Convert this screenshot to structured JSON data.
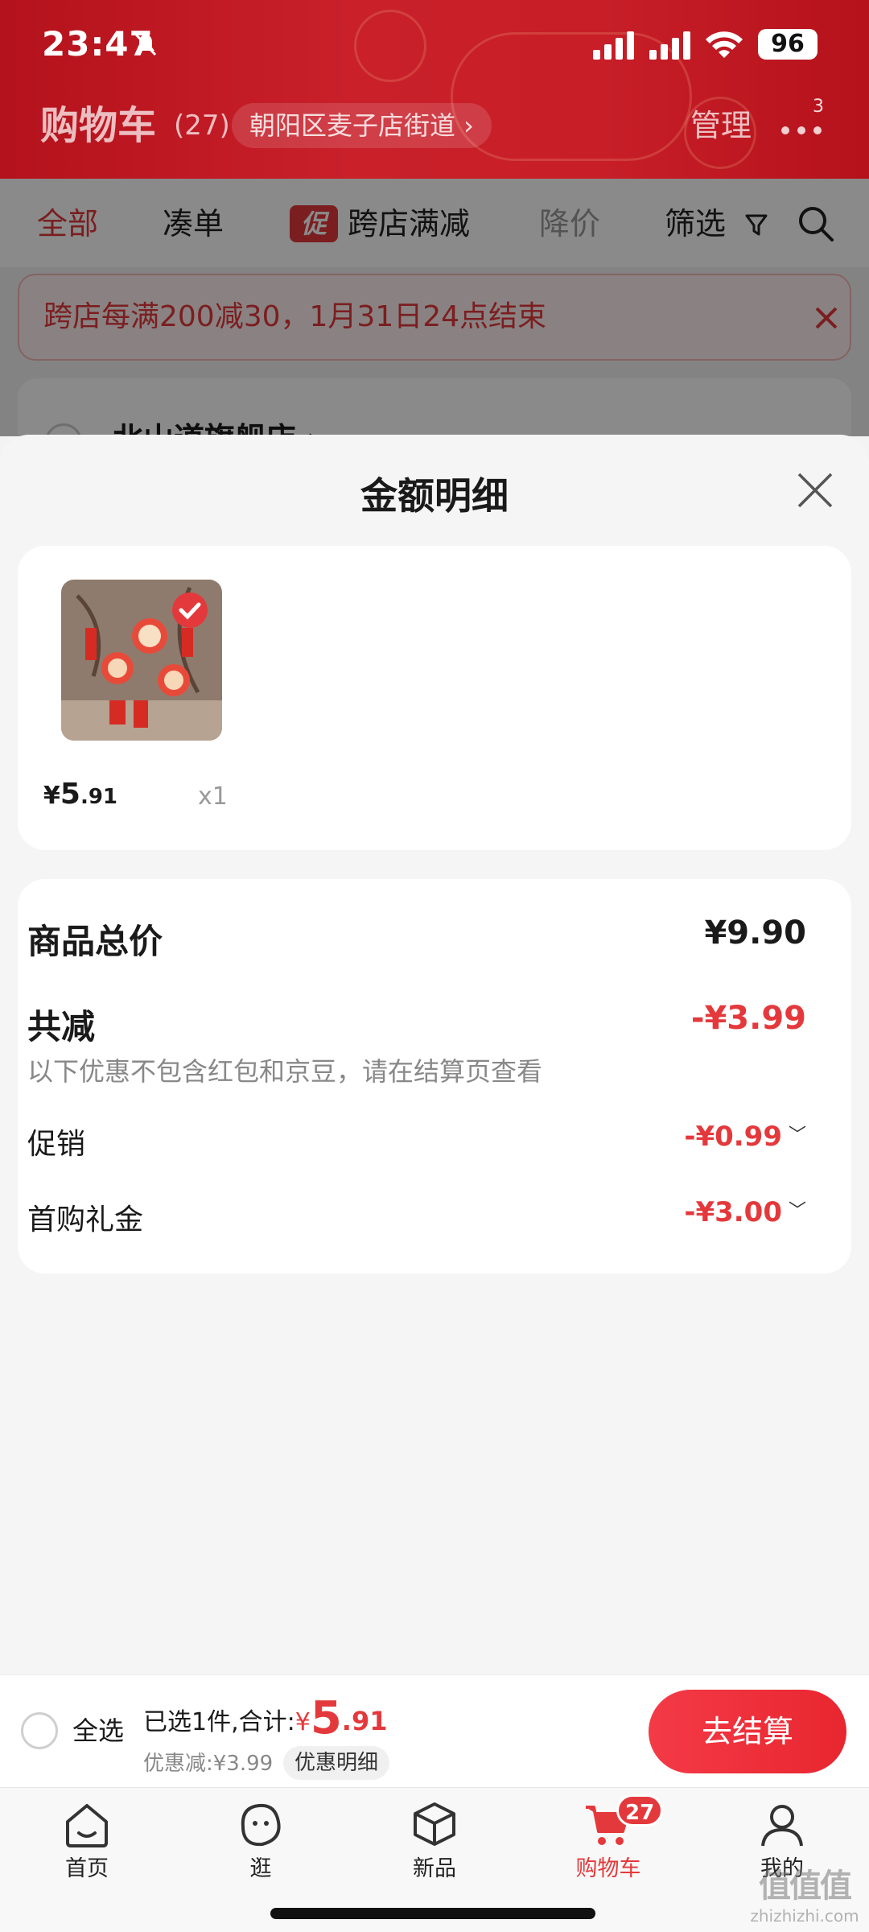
{
  "status_bar": {
    "time": "23:47",
    "battery": "96"
  },
  "header": {
    "title": "购物车",
    "count": "(27)",
    "address": "朝阳区麦子店街道 ›",
    "manage": "管理",
    "more_badge": "3"
  },
  "tabs": {
    "all": "全部",
    "bundle": "凑单",
    "promo_tag": "促",
    "cross_store": "跨店满减",
    "price_drop": "降价",
    "filter": "筛选"
  },
  "promo_banner": {
    "text": "跨店每满200减30，1月31日24点结束"
  },
  "store": {
    "name": "北山道旗舰店 ›"
  },
  "sheet": {
    "title": "金额明细",
    "item": {
      "price_symbol": "¥",
      "price_int": "5",
      "price_dec": ".91",
      "qty": "x1"
    },
    "total_label": "商品总价",
    "total_value": "¥9.90",
    "reduce_label": "共减",
    "reduce_value": "-¥3.99",
    "note": "以下优惠不包含红包和京豆，请在结算页查看",
    "promo_label": "促销",
    "promo_value": "-¥0.99",
    "gift_label": "首购礼金",
    "gift_value": "-¥3.00"
  },
  "checkout": {
    "select_all": "全选",
    "summary_prefix": "已选1件,合计:",
    "currency": "¥",
    "total_int": "5",
    "total_dec": ".91",
    "discount": "优惠减:¥3.99",
    "discount_detail": "优惠明细",
    "button": "去结算"
  },
  "nav": {
    "items": [
      {
        "label": "首页",
        "icon": "home-icon"
      },
      {
        "label": "逛",
        "icon": "browse-icon"
      },
      {
        "label": "新品",
        "icon": "box-icon"
      },
      {
        "label": "购物车",
        "icon": "cart-icon",
        "badge": "27"
      },
      {
        "label": "我的",
        "icon": "person-icon"
      }
    ]
  },
  "watermark": {
    "line1": "值值值",
    "line2": "zhizhizhi.com"
  },
  "colors": {
    "brand_red": "#e4393c",
    "header_red": "#c71e28"
  }
}
